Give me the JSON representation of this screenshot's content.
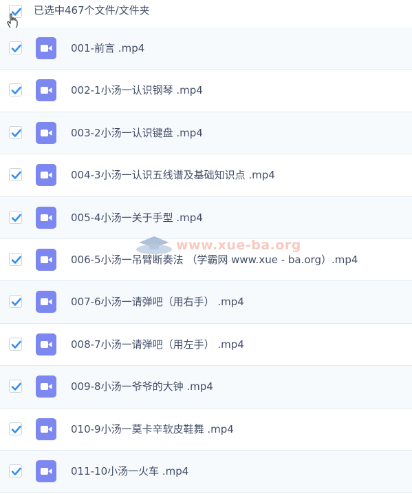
{
  "header": {
    "selection_text": "已选中467个文件/文件夹",
    "checked": true
  },
  "files": [
    {
      "name": "001-前言 .mp4",
      "icon": "video-icon",
      "checked": true
    },
    {
      "name": "002-1小汤一认识钢琴 .mp4",
      "icon": "video-icon",
      "checked": true
    },
    {
      "name": "003-2小汤一认识键盘 .mp4",
      "icon": "video-icon",
      "checked": true
    },
    {
      "name": "004-3小汤一认识五线谱及基础知识点 .mp4",
      "icon": "video-icon",
      "checked": true
    },
    {
      "name": "005-4小汤一关于手型 .mp4",
      "icon": "video-icon",
      "checked": true
    },
    {
      "name": "006-5小汤一吊臂断奏法 （学霸网 www.xue - ba.org）.mp4",
      "icon": "video-icon",
      "checked": true
    },
    {
      "name": "007-6小汤一请弹吧（用右手） .mp4",
      "icon": "video-icon",
      "checked": true
    },
    {
      "name": "008-7小汤一请弹吧（用左手） .mp4",
      "icon": "video-icon",
      "checked": true
    },
    {
      "name": "009-8小汤一爷爷的大钟 .mp4",
      "icon": "video-icon",
      "checked": true
    },
    {
      "name": "010-9小汤一莫卡辛软皮鞋舞 .mp4",
      "icon": "video-icon",
      "checked": true
    },
    {
      "name": "011-10小汤一火车 .mp4",
      "icon": "video-icon",
      "checked": true
    }
  ],
  "watermark": {
    "text": "www.xue-ba.org"
  },
  "colors": {
    "accent": "#2f8ff0",
    "file_icon": "#7d87f0",
    "text": "#424e67",
    "row_alt": "#f7fafd",
    "divider": "#e2ebf3"
  }
}
